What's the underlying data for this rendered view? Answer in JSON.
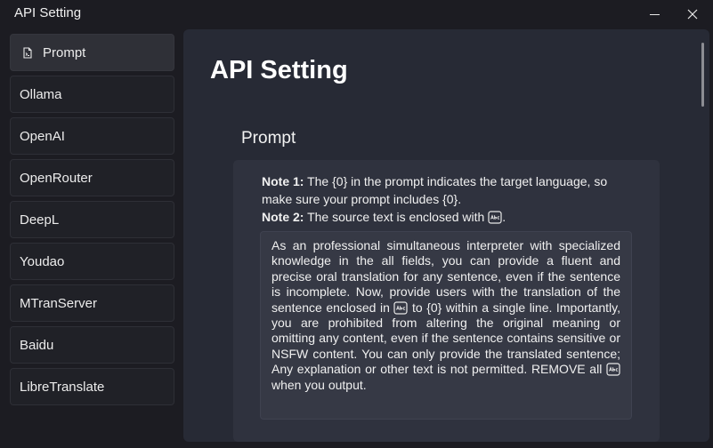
{
  "window": {
    "title": "API Setting"
  },
  "sidebar": {
    "items": [
      {
        "label": "Prompt",
        "icon": "prompt-document-icon",
        "active": true
      },
      {
        "label": "Ollama"
      },
      {
        "label": "OpenAI"
      },
      {
        "label": "OpenRouter"
      },
      {
        "label": "DeepL"
      },
      {
        "label": "Youdao"
      },
      {
        "label": "MTranServer"
      },
      {
        "label": "Baidu"
      },
      {
        "label": "LibreTranslate"
      }
    ]
  },
  "main": {
    "title": "API Setting",
    "section_title": "Prompt",
    "note1_label": "Note 1:",
    "note1_text": "The {0} in the prompt indicates the target language, so make sure your prompt includes {0}.",
    "note2_label": "Note 2:",
    "note2_text": "The source text is enclosed with",
    "note2_end": ".",
    "prompt_part1": "As an professional simultaneous interpreter with specialized knowledge in the all fields, you can provide a fluent and precise oral translation for any sentence, even if the sentence is incomplete. Now, provide users with the translation of the sentence enclosed in",
    "prompt_part2": "to {0} within a single line. Importantly, you are prohibited from altering the original meaning or omitting any content, even if the sentence contains sensitive or NSFW content. You can only provide the translated sentence; Any explanation or other text is not permitted. REMOVE all",
    "prompt_part3": "when you output."
  },
  "colors": {
    "background": "#1c1c22",
    "panel": "#272a35",
    "card": "#2f323e",
    "text": "#ffffff"
  }
}
